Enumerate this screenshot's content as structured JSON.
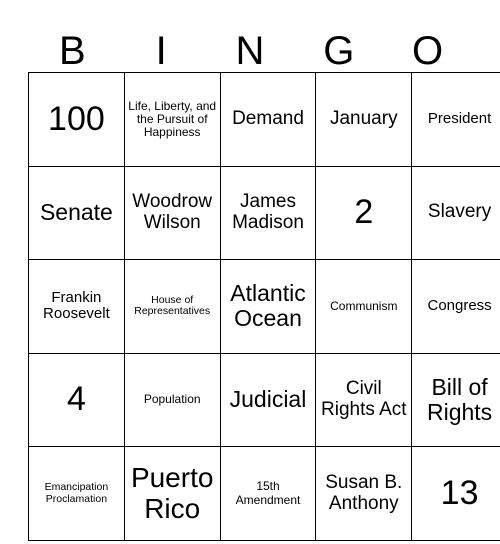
{
  "card": {
    "headers": [
      "B",
      "I",
      "N",
      "G",
      "O"
    ],
    "rows": [
      [
        {
          "text": "100",
          "size": "fs-xxl"
        },
        {
          "text": "Life, Liberty, and the Pursuit of Happiness",
          "size": "fs-xs"
        },
        {
          "text": "Demand",
          "size": "fs-md"
        },
        {
          "text": "January",
          "size": "fs-md"
        },
        {
          "text": "President",
          "size": "fs-sm"
        }
      ],
      [
        {
          "text": "Senate",
          "size": "fs-lg"
        },
        {
          "text": "Woodrow Wilson",
          "size": "fs-md"
        },
        {
          "text": "James Madison",
          "size": "fs-md"
        },
        {
          "text": "2",
          "size": "fs-xxl"
        },
        {
          "text": "Slavery",
          "size": "fs-md"
        }
      ],
      [
        {
          "text": "Frankin Roosevelt",
          "size": "fs-sm"
        },
        {
          "text": "House of Representatives",
          "size": "fs-xxs"
        },
        {
          "text": "Atlantic Ocean",
          "size": "fs-lg"
        },
        {
          "text": "Communism",
          "size": "fs-xs"
        },
        {
          "text": "Congress",
          "size": "fs-sm"
        }
      ],
      [
        {
          "text": "4",
          "size": "fs-xxl"
        },
        {
          "text": "Population",
          "size": "fs-xs"
        },
        {
          "text": "Judicial",
          "size": "fs-lg"
        },
        {
          "text": "Civil Rights Act",
          "size": "fs-md"
        },
        {
          "text": "Bill of Rights",
          "size": "fs-lg"
        }
      ],
      [
        {
          "text": "Emancipation Proclamation",
          "size": "fs-xxs"
        },
        {
          "text": "Puerto Rico",
          "size": "fs-xl"
        },
        {
          "text": "15th Amendment",
          "size": "fs-xs"
        },
        {
          "text": "Susan B. Anthony",
          "size": "fs-md"
        },
        {
          "text": "13",
          "size": "fs-xxl"
        }
      ]
    ]
  },
  "colors": {
    "border": "#000000",
    "text": "#000000",
    "background": "#ffffff"
  }
}
